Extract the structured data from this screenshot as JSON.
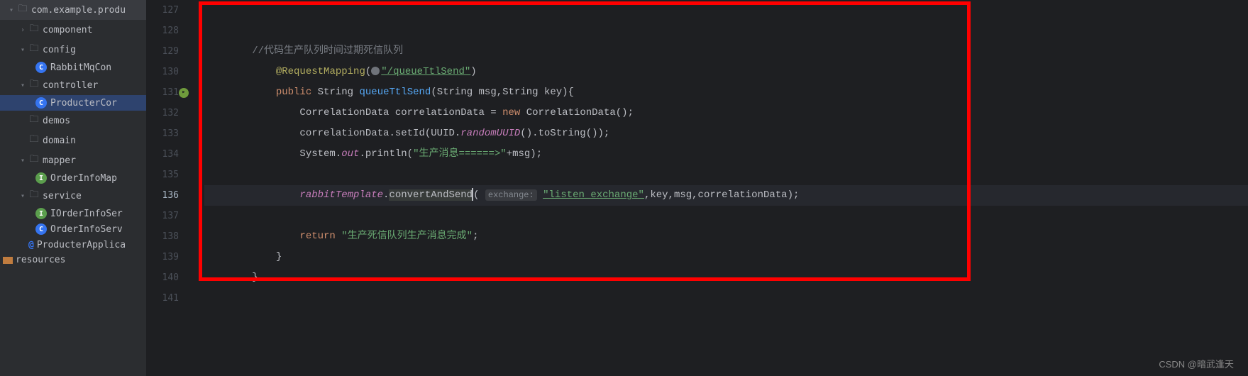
{
  "sidebar": {
    "items": [
      {
        "label": "com.example.produ",
        "type": "folder",
        "indent": 0,
        "chevron": "down"
      },
      {
        "label": "component",
        "type": "folder",
        "indent": 1,
        "chevron": "right"
      },
      {
        "label": "config",
        "type": "folder",
        "indent": 1,
        "chevron": "down"
      },
      {
        "label": "RabbitMqCon",
        "type": "class-c",
        "indent": 2
      },
      {
        "label": "controller",
        "type": "folder",
        "indent": 1,
        "chevron": "down"
      },
      {
        "label": "ProducterCor",
        "type": "class-c",
        "indent": 2,
        "selected": true
      },
      {
        "label": "demos",
        "type": "folder",
        "indent": 1
      },
      {
        "label": "domain",
        "type": "folder",
        "indent": 1
      },
      {
        "label": "mapper",
        "type": "folder",
        "indent": 1,
        "chevron": "down"
      },
      {
        "label": "OrderInfoMap",
        "type": "class-i",
        "indent": 2
      },
      {
        "label": "service",
        "type": "folder",
        "indent": 1,
        "chevron": "down"
      },
      {
        "label": "IOrderInfoSer",
        "type": "class-i",
        "indent": 2
      },
      {
        "label": "OrderInfoServ",
        "type": "class-c",
        "indent": 2
      },
      {
        "label": "ProducterApplica",
        "type": "class-at",
        "indent": 1
      },
      {
        "label": "resources",
        "type": "resources",
        "indent": 0
      }
    ]
  },
  "gutter": {
    "lines": [
      "127",
      "128",
      "129",
      "130",
      "131",
      "132",
      "133",
      "134",
      "135",
      "136",
      "137",
      "138",
      "139",
      "140",
      "141"
    ],
    "active": "136",
    "marker": "131"
  },
  "code": {
    "comment": "//代码生产队列时间过期死信队列",
    "annotation_name": "@RequestMapping",
    "mapping_path": "\"/queueTtlSend\"",
    "kw_public": "public",
    "type_string": "String",
    "method_name": "queueTtlSend",
    "params": "(String msg,String key){",
    "correlation_type": "CorrelationData",
    "correlation_var": "correlationData",
    "kw_new": "new",
    "correlation_ctor": "CorrelationData()",
    "setid": ".setId(UUID.",
    "random_uuid": "randomUUID",
    "tostring": "().toString());",
    "system": "System.",
    "out": "out",
    "println": ".println(",
    "println_str": "\"生产消息======>\"",
    "println_end": "+msg);",
    "rabbit_tmpl": "rabbitTemplate",
    "convert_send": "convertAndSend",
    "exchange_hint": "exchange:",
    "exchange_str": "\"listen_exchange\"",
    "rest_params": ",key,msg,correlationData);",
    "kw_return": "return",
    "return_str": "\"生产死信队列生产消息完成\"",
    "brace_close": "}"
  },
  "watermark": "CSDN @暗武逢天"
}
